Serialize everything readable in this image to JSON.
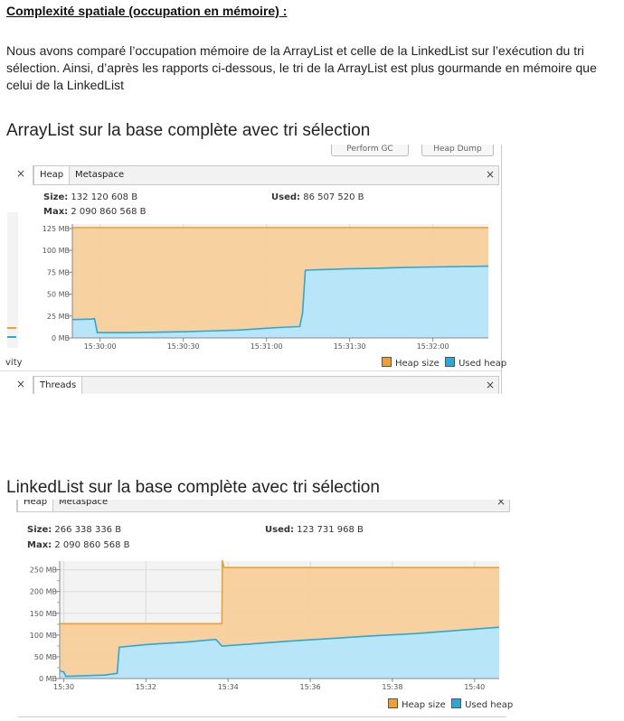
{
  "heading": "Complexité spatiale (occupation en mémoire) :",
  "paragraph": "Nous avons comparé l’occupation mémoire de la ArrayList  et celle de la LinkedList sur l’exécution du tri sélection. Ainsi, d’après les rapports ci-dessous, le tri de la ArrayList est plus gourmande en mémoire que celui de la LinkedList",
  "captions": {
    "arraylist": "ArrayList sur la base complète avec tri sélection",
    "linkedlist": "LinkedList sur la base complète avec tri sélection"
  },
  "panel1": {
    "buttons": {
      "perform_gc": "Perform GC",
      "heap_dump": "Heap Dump"
    },
    "tabs": {
      "heap": "Heap",
      "metaspace": "Metaspace"
    },
    "size_label": "Size:",
    "size_value": "132 120 608 B",
    "used_label": "Used:",
    "used_value": "86 507 520 B",
    "max_label": "Max:",
    "max_value": "2 090 860 568 B",
    "left_fragment": "vity",
    "threads_tab": "Threads",
    "legend": {
      "heap_size": "Heap size",
      "used_heap": "Used heap"
    }
  },
  "panel2": {
    "tabs": {
      "heap": "Heap",
      "metaspace": "Metaspace"
    },
    "size_label": "Size:",
    "size_value": "266 338 336 B",
    "used_label": "Used:",
    "used_value": "123 731 968 B",
    "max_label": "Max:",
    "max_value": "2 090 860 568 B",
    "legend": {
      "heap_size": "Heap size",
      "used_heap": "Used heap"
    }
  },
  "colors": {
    "heap_line": "#f0a030",
    "heap_fill": "#f7cd97",
    "used_line": "#2aa8d8",
    "used_fill": "#b8e6f8",
    "plot_bg": "#f3f3f3"
  },
  "chart_data": [
    {
      "type": "area",
      "ylabel": "",
      "yticks": [
        "0 MB",
        "25 MB",
        "50 MB",
        "75 MB",
        "100 MB",
        "125 MB"
      ],
      "ytick_values": [
        0,
        25,
        50,
        75,
        100,
        125
      ],
      "xticks": [
        "15:30:00",
        "15:30:30",
        "15:31:00",
        "15:31:30",
        "15:32:00"
      ],
      "xtick_values": [
        0,
        30,
        60,
        90,
        120
      ],
      "xlim": [
        -10,
        140
      ],
      "ylim": [
        0,
        130
      ],
      "series": [
        {
          "name": "Heap size",
          "x": [
            -10,
            140
          ],
          "values": [
            126,
            126
          ]
        },
        {
          "name": "Used heap",
          "x": [
            -10,
            -3,
            -2,
            -1,
            10,
            20,
            30,
            40,
            50,
            55,
            60,
            65,
            72,
            73,
            74,
            75,
            80,
            90,
            100,
            110,
            120,
            130,
            140
          ],
          "values": [
            21,
            21.5,
            22,
            6,
            6,
            6.5,
            7,
            8,
            9,
            10,
            11,
            12,
            13,
            28,
            77,
            77.5,
            78,
            79,
            79.5,
            80.5,
            81,
            81.5,
            82
          ]
        }
      ]
    },
    {
      "type": "area",
      "ylabel": "",
      "yticks": [
        "0 MB",
        "50 MB",
        "100 MB",
        "150 MB",
        "200 MB",
        "250 MB"
      ],
      "ytick_values": [
        0,
        50,
        100,
        150,
        200,
        250
      ],
      "ytick_minor": [
        25,
        75,
        125,
        175,
        225
      ],
      "xticks": [
        "15:30",
        "15:32",
        "15:34",
        "15:36",
        "15:38",
        "15:40"
      ],
      "xtick_values": [
        0,
        2,
        4,
        6,
        8,
        10
      ],
      "xlim": [
        -0.1,
        10.6
      ],
      "ylim": [
        0,
        270
      ],
      "series": [
        {
          "name": "Heap size",
          "x": [
            -0.1,
            3.85,
            3.86,
            3.9,
            10.6
          ],
          "values": [
            126,
            126,
            272,
            255,
            255
          ]
        },
        {
          "name": "Used heap",
          "x": [
            -0.1,
            0.0,
            0.05,
            1.0,
            1.3,
            1.35,
            2.0,
            3.0,
            3.7,
            3.85,
            3.9,
            4.5,
            5.5,
            6.5,
            7.5,
            8.5,
            9.5,
            10.6
          ],
          "values": [
            18,
            15,
            5,
            8,
            12,
            72,
            78,
            84,
            90,
            75,
            75,
            79,
            86,
            92,
            98,
            103,
            110,
            118
          ]
        }
      ]
    }
  ]
}
